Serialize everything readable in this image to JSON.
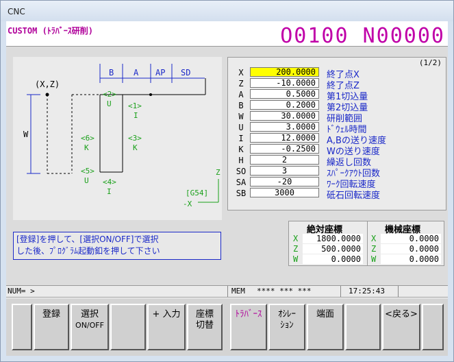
{
  "window": {
    "title": "CNC"
  },
  "header": {
    "mode": "CUSTOM (ﾄﾗﾊﾞｰｽ研削)",
    "program": "O0100 N00000"
  },
  "diagram": {
    "labels": {
      "origin": "(X,Z)",
      "b": "B",
      "a": "A",
      "ap": "AP",
      "sd": "SD",
      "w": "W",
      "p1": "<1>",
      "p1ax": "I",
      "p2": "<2>",
      "p2ax": "U",
      "p3": "<3>",
      "p3ax": "K",
      "p4": "<4>",
      "p4ax": "I",
      "p5": "<5>",
      "p5ax": "U",
      "p6": "<6>",
      "p6ax": "K",
      "zaxis": "Z",
      "xaxis": "-X",
      "coord": "[G54]"
    }
  },
  "params": {
    "page": "(1/2)",
    "rows": [
      {
        "label": "X",
        "value": "200.0000",
        "desc": "終了点X"
      },
      {
        "label": "Z",
        "value": "-10.0000",
        "desc": "終了点Z"
      },
      {
        "label": "A",
        "value": "0.5000",
        "desc": "第1切込量"
      },
      {
        "label": "B",
        "value": "0.2000",
        "desc": "第2切込量"
      },
      {
        "label": "W",
        "value": "30.0000",
        "desc": "研削範囲"
      },
      {
        "label": "U",
        "value": "3.0000",
        "desc": "ﾄﾞｳｪﾙ時間"
      },
      {
        "label": "I",
        "value": "12.0000",
        "desc": "A,Bの送り速度"
      },
      {
        "label": "K",
        "value": "-0.2500",
        "desc": "Wの送り速度"
      },
      {
        "label": "H",
        "value": "2",
        "desc": "繰返し回数"
      },
      {
        "label": "SO",
        "value": "3",
        "desc": "ｽﾊﾟｰｸｱｳﾄ回数"
      },
      {
        "label": "SA",
        "value": "-20",
        "desc": "ﾜｰｸ回転速度"
      },
      {
        "label": "SB",
        "value": "3000",
        "desc": "砥石回転速度"
      }
    ]
  },
  "message": {
    "line1": "[登録]を押して、[選択ON/OFF]で選択",
    "line2": "した後、ﾌﾟﾛｸﾞﾗﾑ起動釦を押して下さい"
  },
  "coords": {
    "abs_title": "絶対座標",
    "mach_title": "機械座標",
    "rows": [
      {
        "axis": "X",
        "abs": "1800.0000",
        "mach_axis": "X",
        "mach": "0.0000"
      },
      {
        "axis": "Z",
        "abs": "500.0000",
        "mach_axis": "Z",
        "mach": "0.0000"
      },
      {
        "axis": "W",
        "abs": "0.0000",
        "mach_axis": "W",
        "mach": "0.0000"
      }
    ]
  },
  "status": {
    "num": "NUM= >",
    "mode": "MEM",
    "stars": "**** *** ***",
    "time": "17:25:43"
  },
  "softkeys": {
    "register": "登録",
    "select1": "選択",
    "select2": "ON/OFF",
    "input": "+ 入力",
    "coord1": "座標",
    "coord2": "切替",
    "traverse": "ﾄﾗﾊﾞｰｽ",
    "osc1": "ｵｼﾚｰ",
    "osc2": "ｼｮﾝ",
    "face": "端面",
    "back": "<戻る>"
  },
  "colors": {
    "accent": "#c000a8",
    "label_blue": "#1a28c8",
    "diagram_green": "#1aa01a",
    "selected": "#ffff00"
  }
}
